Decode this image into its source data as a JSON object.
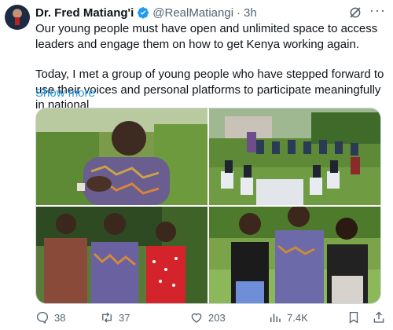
{
  "author": {
    "name": "Dr. Fred Matiang'i",
    "handle": "@RealMatiangi",
    "separator": "·",
    "time": "3h"
  },
  "tweet": {
    "paragraph1": "Our young people must have open and unlimited space to access leaders and engage them on how to get Kenya working again.",
    "paragraph2": "Today, I met a group of young people who have stepped forward to use their voices and personal platforms to participate meaningfully in national",
    "show_more": "Show more"
  },
  "metrics": {
    "replies": "38",
    "reposts": "37",
    "likes": "203",
    "views": "7.4K"
  },
  "icons": {
    "verified": "verified-badge-icon",
    "grok": "grok-icon",
    "more": "more-icon",
    "reply": "reply-icon",
    "repost": "repost-icon",
    "like": "like-icon",
    "views": "views-icon",
    "bookmark": "bookmark-icon",
    "share": "share-icon"
  },
  "colors": {
    "accent": "#1d9bf0",
    "muted": "#536471",
    "text": "#0f1419"
  }
}
